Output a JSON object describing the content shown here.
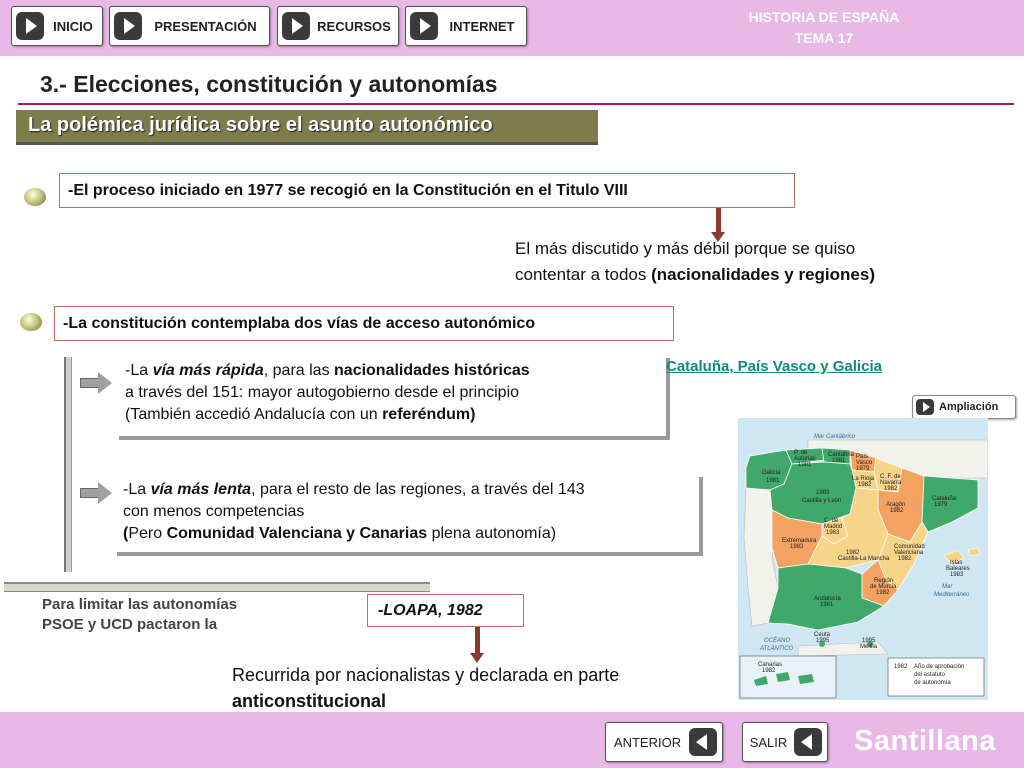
{
  "header": {
    "nav": [
      "INICIO",
      "PRESENTACIÓN",
      "RECURSOS",
      "INTERNET"
    ],
    "title_line1": "HISTORIA DE ESPAÑA",
    "title_line2": "TEMA 17"
  },
  "slide": {
    "title": "3.- Elecciones, constitución y autonomías",
    "subtitle": "La polémica jurídica sobre el asunto autonómico"
  },
  "content": {
    "box1": "-El proceso iniciado en 1977 se recogió en la Constitución en el Titulo VIII",
    "note1_a": "El más discutido y más débil porque se quiso",
    "note1_b": "contentar a todos ",
    "note1_c": "(nacionalidades y regiones)",
    "box2": "-La constitución contemplaba dos vías de acceso autonómico",
    "fast": {
      "p1": "-La ",
      "p2": "vía más rápida",
      "p3": ", para las ",
      "p4": "nacionalidades históricas",
      "p5": "a través del 151: mayor autogobierno desde el principio",
      "p6": "(También  accedió Andalucía con un ",
      "p7": "referéndum)"
    },
    "slow": {
      "p1": "-La ",
      "p2": "vía más lenta",
      "p3": ", para el resto de las regiones, a través del 143",
      "p4": "con menos competencias",
      "p5": "(",
      "p6": "Pero ",
      "p7": "Comunidad Valenciana y Canarias",
      "p8": " plena autonomía)"
    },
    "link": "Cataluña, País Vasco y Galicia",
    "ampliacion": "Ampliación",
    "limit_a": "Para limitar las autonomías",
    "limit_b": "PSOE y UCD pactaron la",
    "loapa_dash": "- ",
    "loapa": "LOAPA, 1982",
    "recurrida_a": "Recurrida por nacionalistas y declarada en parte",
    "recurrida_b": "anticonstitucional"
  },
  "map": {
    "sea_cantabrico": "Mar Cantábrico",
    "sea_mediterraneo_a": "Mar",
    "sea_mediterraneo_b": "Mediterráneo",
    "sea_atlantico_a": "OCÉANO",
    "sea_atlantico_b": "ATLÁNTICO",
    "regions": [
      {
        "name": "P. de",
        "name2": "Asturias",
        "year": "1981"
      },
      {
        "name": "Cantabria",
        "year": "1981"
      },
      {
        "name": "País",
        "name2": "Vasco",
        "year": "1979"
      },
      {
        "name": "Galicia",
        "year": "1981"
      },
      {
        "name": "C. F. de",
        "name2": "Navarra",
        "year": "1982"
      },
      {
        "name": "La Rioja",
        "year": "1982"
      },
      {
        "name": "Castilla y León",
        "year": "1983"
      },
      {
        "name": "Aragón",
        "year": "1982"
      },
      {
        "name": "Cataluña",
        "year": "1979"
      },
      {
        "name": "C. de",
        "name2": "Madrid",
        "year": "1983"
      },
      {
        "name": "Extremadura",
        "year": "1983"
      },
      {
        "name": "Castilla-La Mancha",
        "year": "1982"
      },
      {
        "name": "Comunidad",
        "name2": "Valenciana",
        "year": "1982"
      },
      {
        "name": "Islas",
        "name2": "Baleares",
        "year": "1983"
      },
      {
        "name": "Región",
        "name2": "de Murcia",
        "year": "1982"
      },
      {
        "name": "Andalucía",
        "year": "1981"
      },
      {
        "name": "Ceuta",
        "year": "1995"
      },
      {
        "name": "Melilla",
        "year": "1995"
      },
      {
        "name": "Canarias",
        "year": "1982"
      }
    ],
    "legend_year": "1982",
    "legend_text_a": "Año de aprobación",
    "legend_text_b": "del estatuto",
    "legend_text_c": "de autonomía"
  },
  "footer": {
    "anterior": "ANTERIOR",
    "salir": "SALIR",
    "brand": "Santillana"
  },
  "colors": {
    "header_bg": "#e8b8e6",
    "title_rule": "#b0126a",
    "subtitle_band": "#7d7d4c",
    "link": "#0e8a7a"
  }
}
